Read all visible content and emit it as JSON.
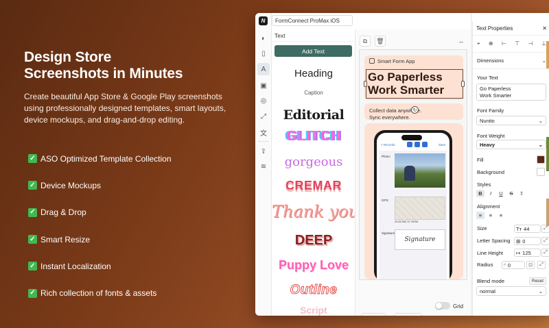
{
  "hero": {
    "title_line1": "Design Store",
    "title_line2": "Screenshots in Minutes",
    "description": "Create beautiful App Store & Google Play screenshots using professionally designed templates, smart layouts, device mockups, and drag-and-drop editing."
  },
  "features": [
    "ASO Optimized Template Collection",
    "Device Mockups",
    "Drag & Drop",
    "Smart Resize",
    "Instant Localization",
    "Rich collection of fonts & assets"
  ],
  "app": {
    "logo": "N",
    "project_name": "FormConnect ProMax iOS",
    "rail_icons": [
      "palette-icon",
      "device-icon",
      "text-icon",
      "image-icon",
      "shapes-icon",
      "resize-icon",
      "translate-icon",
      "export-icon",
      "layers-icon"
    ],
    "text_panel": {
      "title": "Text",
      "add_button": "Add Text",
      "presets": [
        "Heading",
        "Caption",
        "Editorial",
        "GLITCH",
        "gorgeous",
        "CREMAR",
        "Thank you",
        "DEEP",
        "Puppy Love",
        "Outline",
        "Script"
      ]
    },
    "canvas": {
      "app_tag": "Smart Form App",
      "headline_line1": "Go Paperless",
      "headline_line2": "Work Smarter",
      "sub_line1": "Collect data anywhere.",
      "sub_line2": "Sync everywhere.",
      "phone": {
        "back": "< Records",
        "save": "Save",
        "photo_label": "Photo:",
        "gps_label": "GPS:",
        "coords": "23.51786 72.76794",
        "signature_label": "Signature:",
        "signature": "Signature"
      },
      "padding_value": "89",
      "spacing_value": "32",
      "grid_label": "Grid"
    },
    "properties": {
      "title": "Text Properties",
      "close": "✕",
      "dimensions_label": "Dimensions",
      "your_text_label": "Your Text",
      "your_text_line1": "Go Paperless",
      "your_text_line2": "Work Smarter",
      "font_family_label": "Font Family",
      "font_family_value": "Nunito",
      "font_weight_label": "Font Weight",
      "font_weight_value": "Heavy",
      "fill_label": "Fill",
      "fill_color": "#5a2a10",
      "background_label": "Background",
      "styles_label": "Styles",
      "alignment_label": "Alignment",
      "size_label": "Size",
      "size_value": "44",
      "letter_spacing_label": "Letter Spacing",
      "letter_spacing_value": "0",
      "line_height_label": "Line Height",
      "line_height_value": "125",
      "radius_label": "Radius",
      "radius_value": "0",
      "blend_mode_label": "Blend mode",
      "reset_label": "Reset",
      "blend_mode_value": "normal"
    }
  },
  "colors": {
    "accent_button": "#3e6b64",
    "check_green": "#3fb950",
    "card_peach": "#fde1d3"
  }
}
